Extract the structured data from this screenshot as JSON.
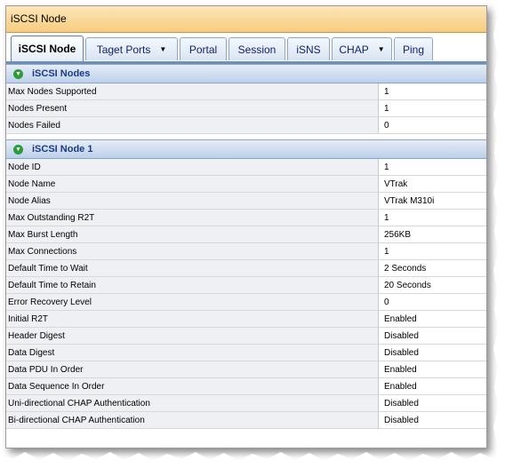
{
  "window": {
    "title": "iSCSI Node"
  },
  "tabs": [
    {
      "label": "iSCSI Node",
      "active": true,
      "dropdown": false
    },
    {
      "label": "Taget Ports",
      "active": false,
      "dropdown": true
    },
    {
      "label": "Portal",
      "active": false,
      "dropdown": false
    },
    {
      "label": "Session",
      "active": false,
      "dropdown": false
    },
    {
      "label": "iSNS",
      "active": false,
      "dropdown": false
    },
    {
      "label": "CHAP",
      "active": false,
      "dropdown": true
    },
    {
      "label": "Ping",
      "active": false,
      "dropdown": false
    }
  ],
  "sections": [
    {
      "title": "iSCSI Nodes",
      "rows": [
        {
          "label": "Max Nodes Supported",
          "value": "1"
        },
        {
          "label": "Nodes Present",
          "value": "1"
        },
        {
          "label": "Nodes Failed",
          "value": "0"
        }
      ]
    },
    {
      "title": "iSCSI Node 1",
      "rows": [
        {
          "label": "Node ID",
          "value": "1"
        },
        {
          "label": "Node Name",
          "value": "VTrak"
        },
        {
          "label": "Node Alias",
          "value": "VTrak M310i"
        },
        {
          "label": "Max Outstanding R2T",
          "value": "1"
        },
        {
          "label": "Max Burst Length",
          "value": "256KB"
        },
        {
          "label": "Max Connections",
          "value": "1"
        },
        {
          "label": "Default Time to Wait",
          "value": "2 Seconds"
        },
        {
          "label": "Default Time to Retain",
          "value": "20 Seconds"
        },
        {
          "label": "Error Recovery Level",
          "value": "0"
        },
        {
          "label": "Initial R2T",
          "value": "Enabled"
        },
        {
          "label": "Header Digest",
          "value": "Disabled"
        },
        {
          "label": "Data Digest",
          "value": "Disabled"
        },
        {
          "label": "Data PDU In Order",
          "value": "Enabled"
        },
        {
          "label": "Data Sequence In Order",
          "value": "Enabled"
        },
        {
          "label": "Uni-directional CHAP Authentication",
          "value": "Disabled"
        },
        {
          "label": "Bi-directional CHAP Authentication",
          "value": "Disabled"
        }
      ]
    }
  ],
  "colors": {
    "title_bar": "#f7cc7f",
    "section_header": "#bcd0ea",
    "tab_border": "#5d7fb3",
    "expand_icon": "#2d9b3a"
  },
  "icons": {
    "section_toggle": "collapse-chevron-icon",
    "tab_dropdown": "dropdown-arrow-icon"
  }
}
